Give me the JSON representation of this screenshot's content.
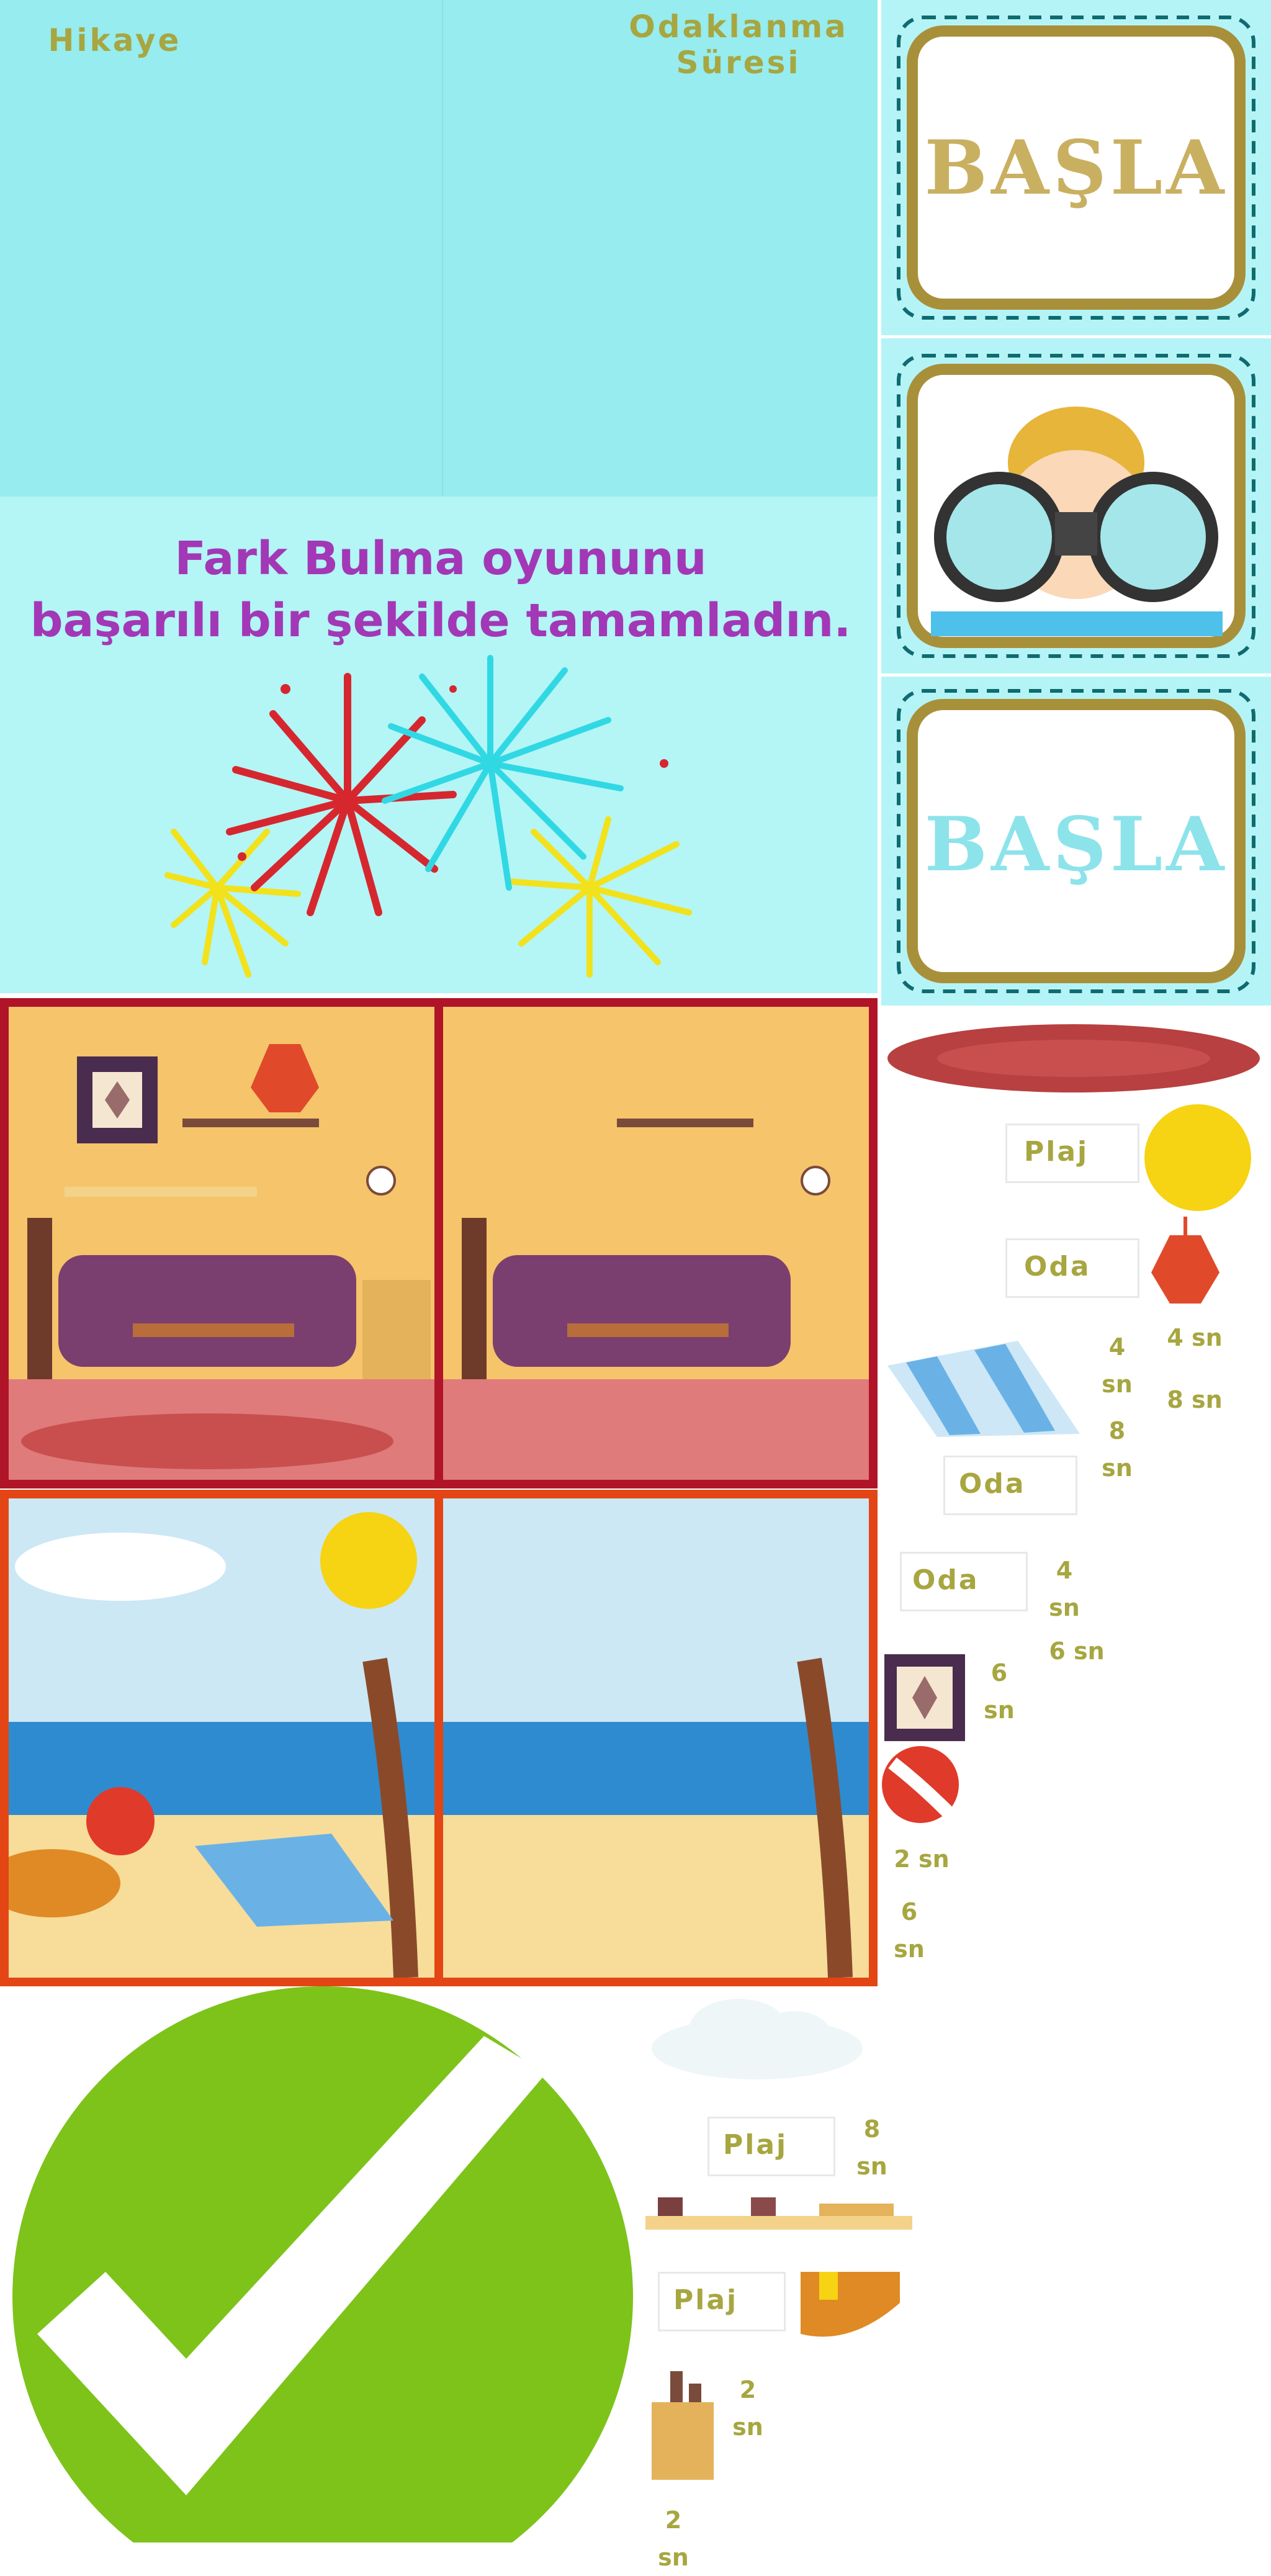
{
  "menu": {
    "story_label": "Hikaye",
    "focus_label_line1": "Odaklanma",
    "focus_label_line2": "Süresi"
  },
  "end_screen": {
    "message_line1": "Fark Bulma oyununu",
    "message_line2": "başarılı bir şekilde tamamladın."
  },
  "buttons": {
    "start_gold": "BAŞLA",
    "start_blue": "BAŞLA"
  },
  "asset_labels": {
    "plaj_1": "Plaj",
    "oda_1": "Oda",
    "oda_2": "Oda",
    "oda_3": "Oda",
    "plaj_2": "Plaj",
    "plaj_3": "Plaj"
  },
  "time_labels": {
    "t4_a": "4\nsn",
    "t4_b": "4 sn",
    "t8_a": "8 sn",
    "t8_b": "8\nsn",
    "t4_c": "4\nsn",
    "t6_a": "6 sn",
    "t6_b": "6\nsn",
    "t2_a": "2 sn",
    "t6_c": "6\nsn",
    "t8_c": "8\nsn",
    "t2_b": "2\nsn",
    "t2_c": "2\nsn"
  },
  "colors": {
    "menu_bg": "#96ecee",
    "gold_text": "#c9b061",
    "blue_text": "#8de3ea",
    "room_frame": "#b01429",
    "beach_frame": "#e34614",
    "check_green": "#7dc31a",
    "label_olive": "#a7a640",
    "message_purple": "#a238b6"
  }
}
